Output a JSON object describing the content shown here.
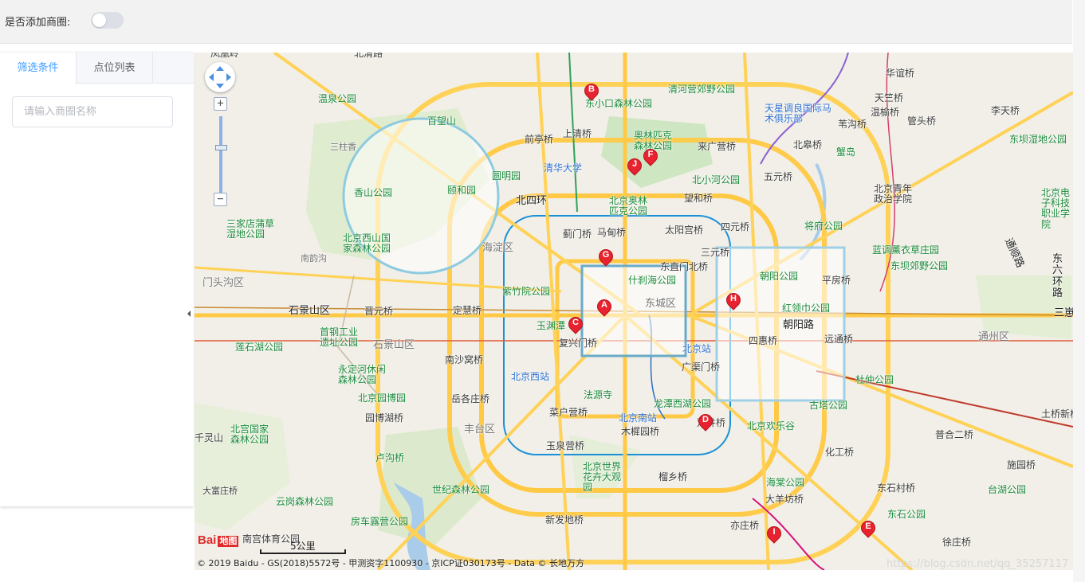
{
  "header": {
    "toggle_label": "是否添加商圈:",
    "toggle_on": false
  },
  "panel": {
    "tabs": [
      {
        "label": "筛选条件",
        "active": true
      },
      {
        "label": "点位列表",
        "active": false
      }
    ],
    "search_placeholder": "请输入商圈名称"
  },
  "map": {
    "markers": [
      "A",
      "B",
      "C",
      "D",
      "E",
      "F",
      "G",
      "H",
      "I",
      "J"
    ],
    "labels": {
      "fengxiang": "凤凰岭",
      "beiqinglu": "北清路",
      "wenquan": "温泉公园",
      "baiwangshan": "百望山",
      "dongxiaokou": "东小口森林公园",
      "qinghe": "清河营郊野公园",
      "huayuanqiao": "华谊桥",
      "tianzhuqiao": "天竺桥",
      "lishiqiao": "李天桥",
      "sanzhuang": "三柱香",
      "qianting": "前亭桥",
      "shangqing": "上清桥",
      "aolin": "奥林匹克森林公园",
      "laiguan": "来广营桥",
      "tianxing": "天星调良国际马术俱乐部",
      "guanliqiao": "温榆桥",
      "wanggouqiao": "苇沟桥",
      "guantou": "管头桥",
      "dongba": "东坝湿地公园",
      "xiangshan": "香山公园",
      "yuanmingyuan": "圆明园",
      "qinghua": "清华大学",
      "yiheyuan": "颐和园",
      "beiyuan": "北小河公园",
      "wuyuan": "五元桥",
      "beigaoqiao": "北皋桥",
      "xieDao": "蟹岛",
      "beisihuan": "北四环",
      "beijingolp": "北京奥林匹克公园",
      "wanghe": "望和桥",
      "beiqingnian": "北京青年政治学院",
      "sanjia": "三家店蒲草湿地公园",
      "xishan": "北京西山国家森林公园",
      "jiangfu": "将府公园",
      "simen": "四元桥",
      "xizhimen": "蓟门桥",
      "mafang": "马甸桥",
      "taiyang": "太阳宫桥",
      "lanjiao": "蓝调薰衣草庄园",
      "haidian": "海淀区",
      "nanyu": "南韵沟",
      "shichahai": "什刹海公园",
      "dongzhimen": "东直门北桥",
      "sanyuan": "三元桥",
      "dongbajiao": "东坝郊野公园",
      "tongshun": "通顺路",
      "chaoyang_park": "朝阳公园",
      "pingfang": "平房桥",
      "mentougou": "门头沟区",
      "zizhuyuan": "紫竹院公园",
      "dongcheng": "东城区",
      "honglingjin": "红领巾公园",
      "dongliu": "东六环路",
      "shijing": "石景山区",
      "shigang": "首钢工业遗址公园",
      "jinyuan": "晋元桥",
      "dinghui": "定慧桥",
      "yuyuantan": "玉渊潭",
      "fuxingmen": "复兴门桥",
      "chaoyanglu": "朝阳路",
      "sihui": "四惠桥",
      "yuanyuan": "远通桥",
      "tongzhou": "通州区",
      "sanzhi": "三崽",
      "lianshi": "莲石湖公园",
      "nanshawo": "南沙窝桥",
      "beijingzhan": "北京站",
      "guangqumen": "广渠门桥",
      "yongding": "永定河休闲森林公园",
      "beijingxizhan": "北京西站",
      "dujia": "杜仲公园",
      "yuegezhuang": "岳各庄桥",
      "fayuan": "法源寺",
      "longtan": "龙潭西湖公园",
      "gutaa": "古塔公园",
      "beiyuanbo": "北京园博园",
      "yuanbohu": "园博湖桥",
      "caihuying": "菜户营桥",
      "beijingnan": "北京南站",
      "shuangqiao": "双井桥",
      "huanle": "北京欢乐谷",
      "tuqiao": "土桥新桥",
      "guojia": "北宫国家森林公园",
      "fengtai": "丰台区",
      "mujiayuan": "木樨园桥",
      "puji": "普合二桥",
      "lingshan": "千灵山",
      "yuquanying": "玉泉营桥",
      "huagong": "化工桥",
      "lugou": "卢沟桥",
      "shijie": "北京世界花卉大观园",
      "liuxiang": "榴乡桥",
      "shiguan": "施园桥",
      "haitang": "海棠公园",
      "dongshi": "东石村桥",
      "taihu": "台湖公园",
      "dayangfang": "大羊坊桥",
      "shiji": "世纪森林公园",
      "yungang": "云岗森林公园",
      "xinfa": "新发地桥",
      "donggong": "东石公园",
      "fangche": "房车露营公园",
      "nangong": "南宫体育公园",
      "yizhuang": "亦庄桥",
      "xuzhuang": "徐庄桥",
      "dafang": "大富庄桥",
      "dongyu": "东六",
      "beijingdian": "北京电子科技职业学院"
    },
    "scale_label": "5公里",
    "copyright": "© 2019 Baidu - GS(2018)5572号 - 甲测资字1100930 - 京ICP证030173号 - Data © 长地万方",
    "logo_text": "Bai",
    "logo_suffix": "地图",
    "zoom_in": "+",
    "zoom_out": "−"
  },
  "watermark": "https://blog.csdn.net/qq_35257117"
}
